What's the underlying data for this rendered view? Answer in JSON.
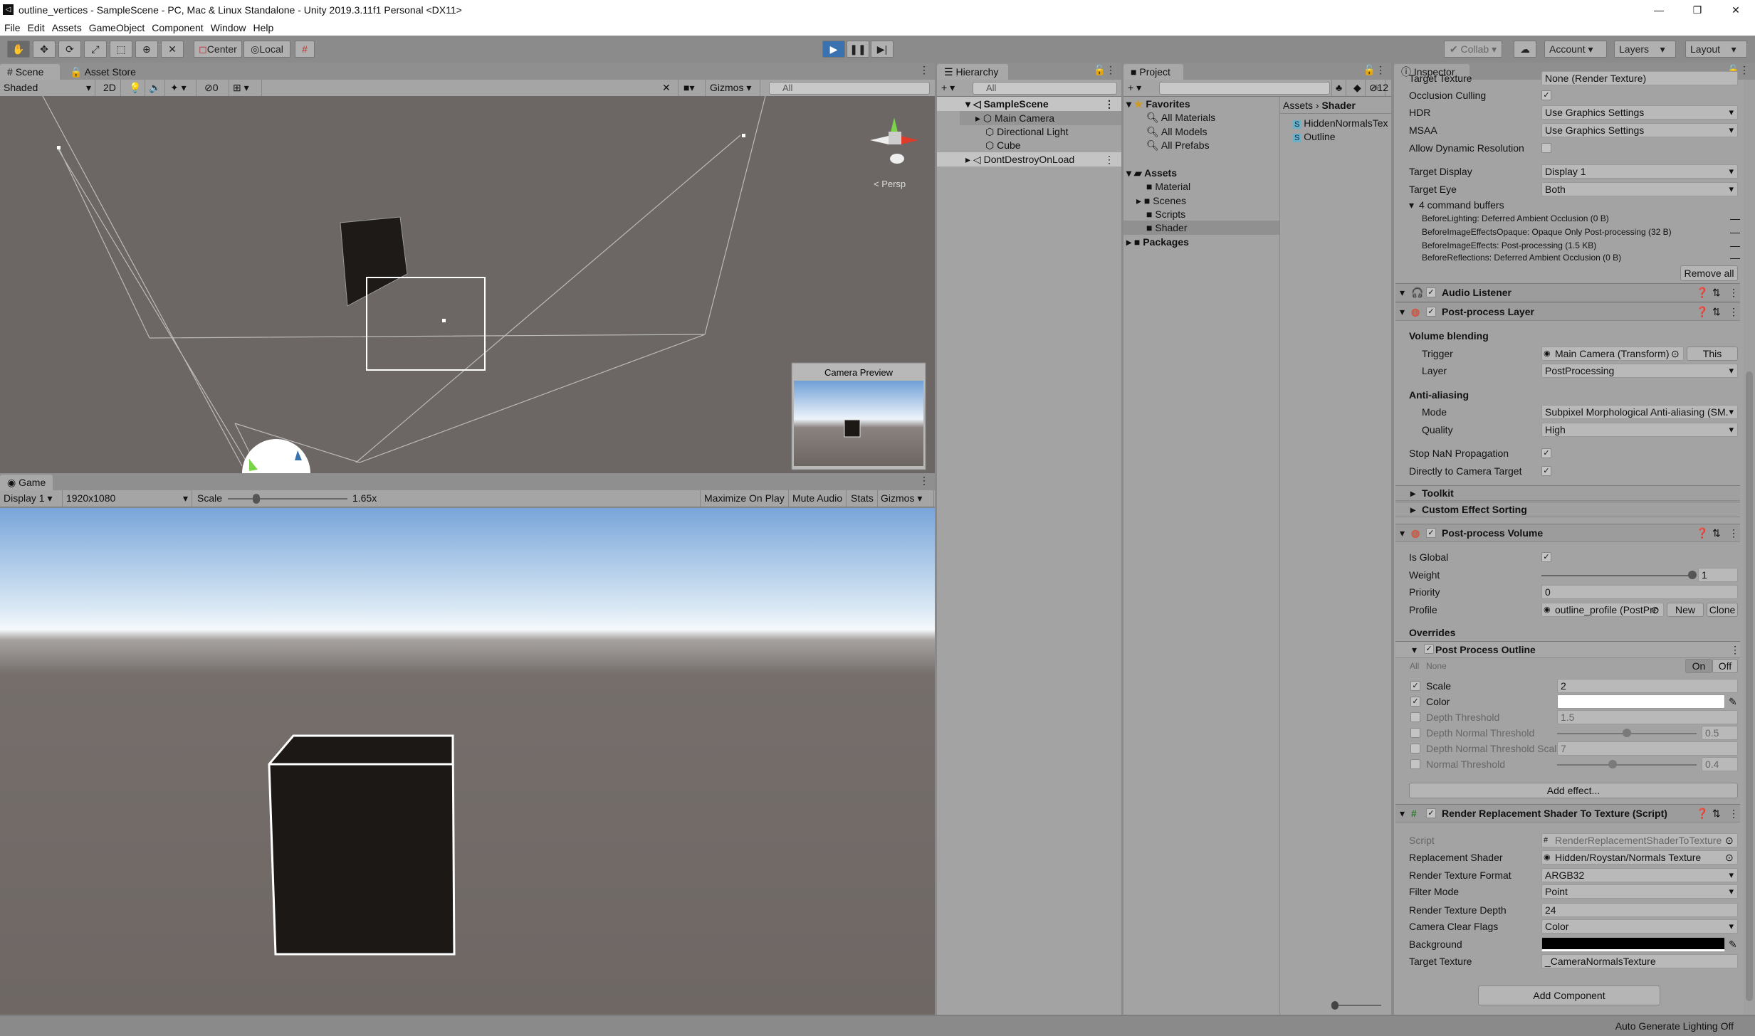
{
  "window": {
    "title": "outline_vertices - SampleScene - PC, Mac & Linux Standalone - Unity 2019.3.11f1 Personal <DX11>",
    "controls": [
      "—",
      "❐",
      "✕"
    ]
  },
  "menu": [
    "File",
    "Edit",
    "Assets",
    "GameObject",
    "Component",
    "Window",
    "Help"
  ],
  "toolbar": {
    "tools": [
      "hand",
      "move",
      "rotate",
      "scale",
      "rect",
      "transform",
      "custom"
    ],
    "pivot": "Center",
    "space": "Local",
    "collab": "Collab",
    "account": "Account",
    "layers": "Layers",
    "layout": "Layout",
    "accent": "#3a72b0"
  },
  "scene": {
    "tabs": [
      "Scene",
      "Asset Store"
    ],
    "draw_mode": "Shaded",
    "mode_2d": "2D",
    "hidden_count": "0",
    "gizmos": "Gizmos",
    "search_placeholder": "All",
    "persp": "< Persp",
    "camera_preview": "Camera Preview"
  },
  "game": {
    "tab": "Game",
    "display": "Display 1",
    "resolution": "1920x1080",
    "scale_label": "Scale",
    "scale_value": "1.65x",
    "scale_fraction": 0.15,
    "buttons": [
      "Maximize On Play",
      "Mute Audio",
      "Stats",
      "Gizmos"
    ]
  },
  "hierarchy": {
    "tab": "Hierarchy",
    "search_placeholder": "All",
    "items": [
      {
        "label": "SampleScene",
        "kind": "scene"
      },
      {
        "label": "Main Camera",
        "kind": "object"
      },
      {
        "label": "Directional Light",
        "kind": "object"
      },
      {
        "label": "Cube",
        "kind": "object"
      },
      {
        "label": "DontDestroyOnLoad",
        "kind": "scene"
      }
    ]
  },
  "project": {
    "tab": "Project",
    "hidden_count": "12",
    "favorites": "Favorites",
    "favorite_items": [
      "All Materials",
      "All Models",
      "All Prefabs"
    ],
    "assets": "Assets",
    "folders": [
      "Material",
      "Scenes",
      "Scripts",
      "Shader"
    ],
    "packages": "Packages",
    "breadcrumb": [
      "Assets",
      "Shader"
    ],
    "files": [
      "HiddenNormalsTex",
      "Outline"
    ]
  },
  "inspector": {
    "tab": "Inspector",
    "rows": [
      {
        "k": "field",
        "label": "Target Texture",
        "value": "None (Render Texture)"
      },
      {
        "k": "check",
        "label": "Occlusion Culling",
        "checked": true
      },
      {
        "k": "dd",
        "label": "HDR",
        "value": "Use Graphics Settings"
      },
      {
        "k": "dd",
        "label": "MSAA",
        "value": "Use Graphics Settings"
      },
      {
        "k": "check",
        "label": "Allow Dynamic Resolution",
        "checked": false
      },
      {
        "k": "dd",
        "label": "Target Display",
        "value": "Display 1"
      },
      {
        "k": "dd",
        "label": "Target Eye",
        "value": "Both"
      },
      {
        "k": "fold",
        "label": "4 command buffers"
      },
      {
        "k": "buf",
        "label": "BeforeLighting: Deferred Ambient Occlusion (0 B)"
      },
      {
        "k": "buf",
        "label": "BeforeImageEffectsOpaque: Opaque Only Post-processing (32 B)"
      },
      {
        "k": "buf",
        "label": "BeforeImageEffects: Post-processing (1.5 KB)"
      },
      {
        "k": "buf",
        "label": "BeforeReflections: Deferred Ambient Occlusion (0 B)"
      },
      {
        "k": "rbtn",
        "label": "Remove all"
      },
      {
        "k": "hdr",
        "label": "Audio Listener",
        "icon": "headphones"
      },
      {
        "k": "hdr",
        "label": "Post-process Layer",
        "icon": "color-wheel"
      },
      {
        "k": "sec",
        "label": "Volume blending"
      },
      {
        "k": "obj",
        "label": "Trigger",
        "value": "Main Camera (Transform)",
        "extra": "This",
        "indent": true
      },
      {
        "k": "dd",
        "label": "Layer",
        "value": "PostProcessing",
        "indent": true
      },
      {
        "k": "sec",
        "label": "Anti-aliasing"
      },
      {
        "k": "dd",
        "label": "Mode",
        "value": "Subpixel Morphological Anti-aliasing (SM.",
        "indent": true
      },
      {
        "k": "dd",
        "label": "Quality",
        "value": "High",
        "indent": true
      },
      {
        "k": "check",
        "label": "Stop NaN Propagation",
        "checked": true
      },
      {
        "k": "check",
        "label": "Directly to Camera Target",
        "checked": true
      },
      {
        "k": "sub",
        "label": "Toolkit"
      },
      {
        "k": "sub",
        "label": "Custom Effect Sorting"
      },
      {
        "k": "hdr",
        "label": "Post-process Volume",
        "icon": "color-wheel"
      },
      {
        "k": "check",
        "label": "Is Global",
        "checked": true
      },
      {
        "k": "slider",
        "label": "Weight",
        "value": "1",
        "fraction": 1
      },
      {
        "k": "field",
        "label": "Priority",
        "value": "0"
      },
      {
        "k": "obj",
        "label": "Profile",
        "value": "outline_profile (PostPrc",
        "extra": "New",
        "extra2": "Clone"
      },
      {
        "k": "sec",
        "label": "Overrides"
      },
      {
        "k": "ovhdr",
        "label": "Post Process Outline"
      },
      {
        "k": "allnone",
        "label": "All",
        "label2": "None",
        "on": "On",
        "off": "Off"
      },
      {
        "k": "ov",
        "label": "Scale",
        "value": "2",
        "checked": true
      },
      {
        "k": "ovcolor",
        "label": "Color",
        "checked": true,
        "color": "#ffffff"
      },
      {
        "k": "ov",
        "label": "Depth Threshold",
        "value": "1.5",
        "checked": false
      },
      {
        "k": "ovslider",
        "label": "Depth Normal Threshold",
        "value": "0.5",
        "fraction": 0.5,
        "checked": false
      },
      {
        "k": "ov",
        "label": "Depth Normal Threshold Scal",
        "value": "7",
        "checked": false
      },
      {
        "k": "ovslider",
        "label": "Normal Threshold",
        "value": "0.4",
        "fraction": 0.4,
        "checked": false
      },
      {
        "k": "wbtn",
        "label": "Add effect..."
      },
      {
        "k": "hdr",
        "label": "Render Replacement Shader To Texture (Script)",
        "icon": "script"
      },
      {
        "k": "objdim",
        "label": "Script",
        "value": "RenderReplacementShaderToTexture"
      },
      {
        "k": "obj",
        "label": "Replacement Shader",
        "value": "Hidden/Roystan/Normals Texture"
      },
      {
        "k": "dd",
        "label": "Render Texture Format",
        "value": "ARGB32"
      },
      {
        "k": "dd",
        "label": "Filter Mode",
        "value": "Point"
      },
      {
        "k": "field",
        "label": "Render Texture Depth",
        "value": "24"
      },
      {
        "k": "dd",
        "label": "Camera Clear Flags",
        "value": "Color"
      },
      {
        "k": "color",
        "label": "Background",
        "color": "#000000"
      },
      {
        "k": "field",
        "label": "Target Texture",
        "value": "_CameraNormalsTexture"
      },
      {
        "k": "addc",
        "label": "Add Component"
      }
    ]
  },
  "status": {
    "text": "Auto Generate Lighting Off"
  }
}
